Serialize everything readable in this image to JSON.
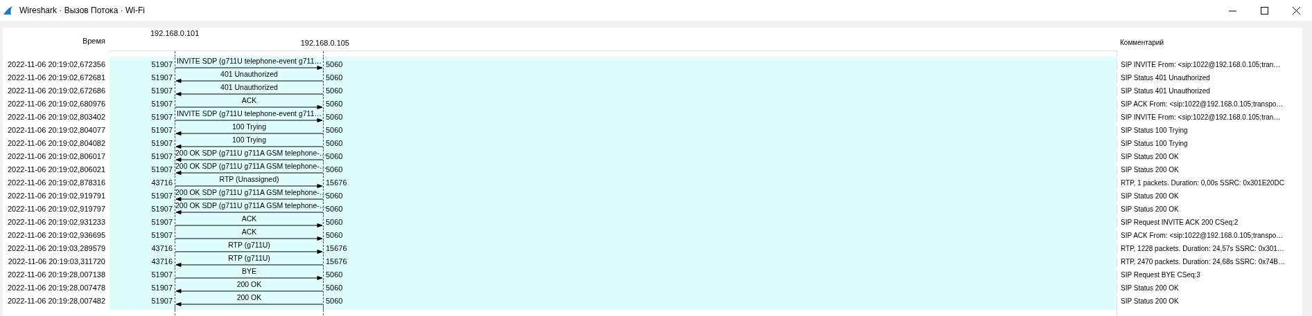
{
  "window": {
    "title": "Wireshark · Вызов Потока · Wi-Fi"
  },
  "headers": {
    "time": "Время",
    "hosts": [
      "192.168.0.101",
      "192.168.0.105"
    ],
    "comment": "Комментарий"
  },
  "rows": [
    {
      "time": "2022-11-06 20:19:02,672356",
      "left_port": "51907",
      "right_port": "5060",
      "label": "INVITE SDP (g711U telephone-event g711…",
      "kind": "forward",
      "comment": "SIP INVITE From: <sip:1022@192.168.0.105;tran…"
    },
    {
      "time": "2022-11-06 20:19:02,672681",
      "left_port": "51907",
      "right_port": "5060",
      "label": "401 Unauthorized",
      "kind": "backward",
      "comment": "SIP Status 401 Unauthorized"
    },
    {
      "time": "2022-11-06 20:19:02,672686",
      "left_port": "51907",
      "right_port": "5060",
      "label": "401 Unauthorized",
      "kind": "backward",
      "comment": "SIP Status 401 Unauthorized"
    },
    {
      "time": "2022-11-06 20:19:02,680976",
      "left_port": "51907",
      "right_port": "5060",
      "label": "ACK",
      "kind": "forward",
      "comment": "SIP ACK From: <sip:1022@192.168.0.105;transpo…"
    },
    {
      "time": "2022-11-06 20:19:02,803402",
      "left_port": "51907",
      "right_port": "5060",
      "label": "INVITE SDP (g711U telephone-event g711…",
      "kind": "forward",
      "comment": "SIP INVITE From: <sip:1022@192.168.0.105;tran…"
    },
    {
      "time": "2022-11-06 20:19:02,804077",
      "left_port": "51907",
      "right_port": "5060",
      "label": "100 Trying",
      "kind": "backward",
      "comment": "SIP Status 100 Trying"
    },
    {
      "time": "2022-11-06 20:19:02,804082",
      "left_port": "51907",
      "right_port": "5060",
      "label": "100 Trying",
      "kind": "backward",
      "comment": "SIP Status 100 Trying"
    },
    {
      "time": "2022-11-06 20:19:02,806017",
      "left_port": "51907",
      "right_port": "5060",
      "label": "200 OK SDP (g711U g711A GSM telephone-…",
      "kind": "backward",
      "comment": "SIP Status 200 OK"
    },
    {
      "time": "2022-11-06 20:19:02,806021",
      "left_port": "51907",
      "right_port": "5060",
      "label": "200 OK SDP (g711U g711A GSM telephone-…",
      "kind": "backward",
      "comment": "SIP Status 200 OK"
    },
    {
      "time": "2022-11-06 20:19:02,878316",
      "left_port": "43716",
      "right_port": "15676",
      "label": "RTP (Unassigned)",
      "kind": "forward",
      "comment": "RTP, 1 packets. Duration: 0,00s SSRC: 0x301E20DC"
    },
    {
      "time": "2022-11-06 20:19:02,919791",
      "left_port": "51907",
      "right_port": "5060",
      "label": "200 OK SDP (g711U g711A GSM telephone-…",
      "kind": "backward",
      "comment": "SIP Status 200 OK"
    },
    {
      "time": "2022-11-06 20:19:02,919797",
      "left_port": "51907",
      "right_port": "5060",
      "label": "200 OK SDP (g711U g711A GSM telephone-…",
      "kind": "backward",
      "comment": "SIP Status 200 OK"
    },
    {
      "time": "2022-11-06 20:19:02,931233",
      "left_port": "51907",
      "right_port": "5060",
      "label": "ACK",
      "kind": "forward",
      "comment": "SIP Request INVITE ACK 200 CSeq:2"
    },
    {
      "time": "2022-11-06 20:19:02,936695",
      "left_port": "51907",
      "right_port": "5060",
      "label": "ACK",
      "kind": "forward",
      "comment": "SIP ACK From: <sip:1022@192.168.0.105;transpo…"
    },
    {
      "time": "2022-11-06 20:19:03,289579",
      "left_port": "43716",
      "right_port": "15676",
      "label": "RTP (g711U)",
      "kind": "forward",
      "comment": "RTP, 1228 packets. Duration: 24,57s SSRC: 0x301…"
    },
    {
      "time": "2022-11-06 20:19:03,311720",
      "left_port": "43716",
      "right_port": "15676",
      "label": "RTP (g711U)",
      "kind": "backward",
      "comment": "RTP, 2470 packets. Duration: 24,68s SSRC: 0x74B…"
    },
    {
      "time": "2022-11-06 20:19:28,007138",
      "left_port": "51907",
      "right_port": "5060",
      "label": "BYE",
      "kind": "forward",
      "comment": "SIP Request BYE CSeq:3"
    },
    {
      "time": "2022-11-06 20:19:28,007478",
      "left_port": "51907",
      "right_port": "5060",
      "label": "200 OK",
      "kind": "backward",
      "comment": "SIP Status 200 OK"
    },
    {
      "time": "2022-11-06 20:19:28,007482",
      "left_port": "51907",
      "right_port": "5060",
      "label": "200 OK",
      "kind": "backward",
      "comment": "SIP Status 200 OK"
    }
  ]
}
